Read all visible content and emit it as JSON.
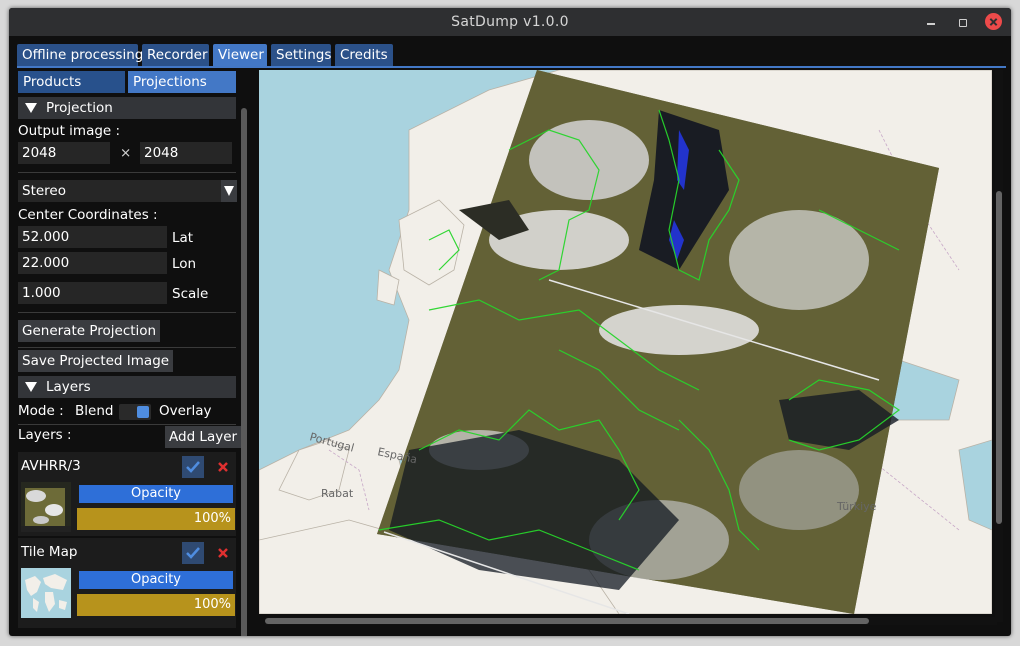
{
  "window": {
    "title": "SatDump v1.0.0"
  },
  "tabs": [
    {
      "label": "Offline processing",
      "active": false
    },
    {
      "label": "Recorder",
      "active": false
    },
    {
      "label": "Viewer",
      "active": true
    },
    {
      "label": "Settings",
      "active": false
    },
    {
      "label": "Credits",
      "active": false
    }
  ],
  "subtabs": {
    "products": "Products",
    "projections": "Projections",
    "active": "Projections"
  },
  "projection": {
    "header": "Projection",
    "output_image_label": "Output image :",
    "width": "2048",
    "times": "×",
    "height": "2048",
    "projection_type": "Stereo",
    "center_label": "Center Coordinates :",
    "lat_value": "52.000",
    "lat_label": "Lat",
    "lon_value": "22.000",
    "lon_label": "Lon",
    "scale_value": "1.000",
    "scale_label": "Scale",
    "generate_button": "Generate Projection",
    "save_button": "Save Projected Image"
  },
  "layers": {
    "header": "Layers",
    "mode_label": "Mode :",
    "mode_blend": "Blend",
    "mode_overlay": "Overlay",
    "mode_selected": "Overlay",
    "layers_label": "Layers :",
    "add_button": "Add Layer",
    "items": [
      {
        "name": "AVHRR/3",
        "enabled": true,
        "opacity_label": "Opacity",
        "opacity_value": "100%",
        "opacity": 1.0
      },
      {
        "name": "Tile Map",
        "enabled": true,
        "opacity_label": "Opacity",
        "opacity_value": "100%",
        "opacity": 1.0
      }
    ]
  },
  "map_labels": [
    "Portugal",
    "España",
    "Rabat",
    "Türkiye"
  ],
  "colors": {
    "tab": "#2b5189",
    "tab_active": "#4378c6",
    "opacity_bar": "#2e6fd8",
    "slider": "#b7931c",
    "close": "#ed4a4a",
    "sea": "#a9d3df",
    "land": "#f2efe9",
    "coastline_overlay": "#27d52b"
  }
}
